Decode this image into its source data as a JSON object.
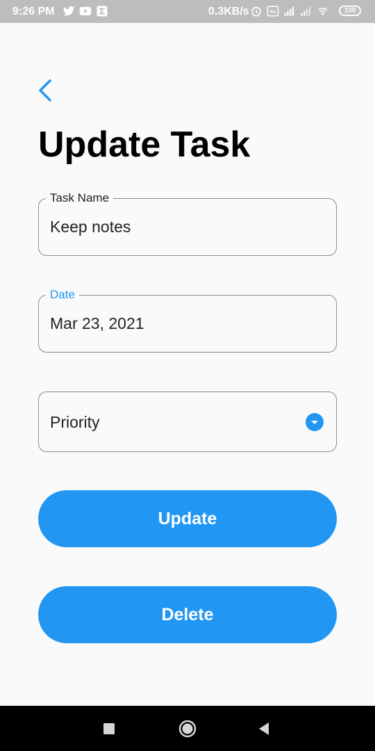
{
  "status_bar": {
    "time": "9:26 PM",
    "network_speed": "0.3KB/s",
    "battery_level": "100",
    "left_icons": [
      "twitter-icon",
      "youtube-icon",
      "sigma-app-icon"
    ],
    "right_icons": [
      "alarm-icon",
      "volte-icon",
      "signal-icon",
      "signal-icon",
      "wifi-icon"
    ]
  },
  "header": {
    "back_icon": "chevron-left-icon",
    "title": "Update Task"
  },
  "form": {
    "task_name": {
      "label": "Task Name",
      "value": "Keep notes"
    },
    "date": {
      "label": "Date",
      "value": "Mar 23, 2021"
    },
    "priority": {
      "value": "Priority",
      "icon": "dropdown-arrow-icon"
    }
  },
  "actions": {
    "update_label": "Update",
    "delete_label": "Delete"
  },
  "colors": {
    "accent": "#2196f3",
    "background": "#fafafa",
    "status_bar": "#bdbdbd",
    "nav_bar": "#000000"
  },
  "nav": {
    "icons": [
      "recent-apps-icon",
      "home-icon",
      "back-icon"
    ]
  }
}
